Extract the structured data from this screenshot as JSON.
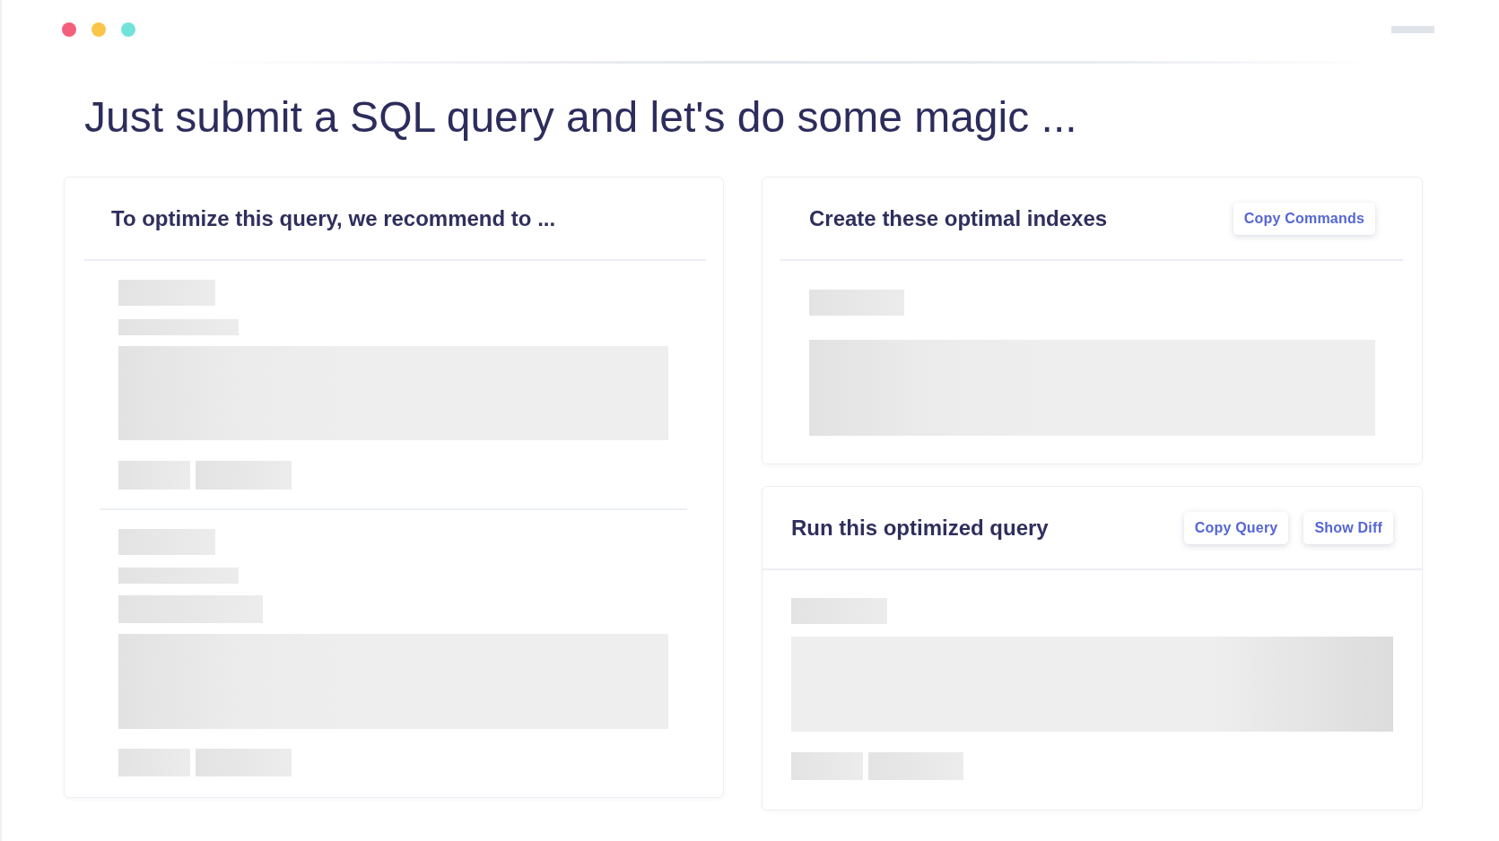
{
  "window": {
    "buttons": [
      {
        "color": "#f2607b"
      },
      {
        "color": "#fbc54a"
      },
      {
        "color": "#72e3da"
      }
    ]
  },
  "heading": "Just submit a SQL query and let's do some magic ...",
  "recommendations": {
    "title": "To optimize this query, we recommend to ...",
    "loading": true
  },
  "indexes": {
    "title": "Create these optimal indexes",
    "loading": true,
    "buttons": [
      "Copy Commands"
    ]
  },
  "optimized_query": {
    "title": "Run this optimized query",
    "loading": true,
    "buttons": [
      "Copy Query",
      "Show Diff"
    ]
  }
}
